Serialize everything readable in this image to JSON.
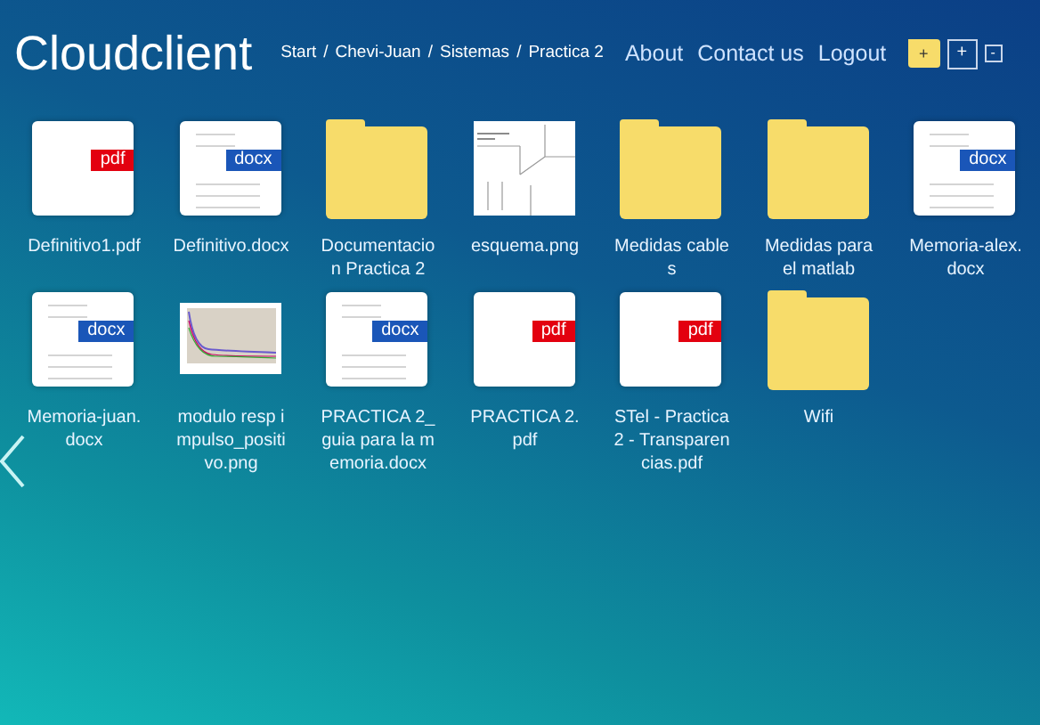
{
  "header": {
    "title": "Cloudclient",
    "breadcrumb": [
      "Start",
      "Chevi-Juan",
      "Sistemas",
      "Practica 2"
    ],
    "breadcrumb_separator": "/",
    "nav": [
      "About",
      "Contact us",
      "Logout"
    ],
    "tools": [
      {
        "kind": "folder",
        "label": "+"
      },
      {
        "kind": "box",
        "label": "+"
      },
      {
        "kind": "small",
        "label": "-"
      }
    ]
  },
  "files": [
    {
      "kind": "pdf",
      "name": "Definitivo1.pdf",
      "tag": "pdf"
    },
    {
      "kind": "docx",
      "name": "Definitivo.docx",
      "tag": "docx"
    },
    {
      "kind": "folder",
      "name": "Documentacion Practica 2"
    },
    {
      "kind": "image",
      "name": "esquema.png"
    },
    {
      "kind": "folder",
      "name": "Medidas cables"
    },
    {
      "kind": "folder",
      "name": "Medidas para el matlab"
    },
    {
      "kind": "docx",
      "name": "Memoria-alex.docx",
      "tag": "docx"
    },
    {
      "kind": "docx",
      "name": "Memoria-juan.docx",
      "tag": "docx"
    },
    {
      "kind": "plot",
      "name": "modulo resp impulso_positivo.png"
    },
    {
      "kind": "docx",
      "name": "PRACTICA 2_guia para la memoria.docx",
      "tag": "docx"
    },
    {
      "kind": "pdf",
      "name": "PRACTICA 2.pdf",
      "tag": "pdf"
    },
    {
      "kind": "pdf",
      "name": "STel - Practica 2 - Transparencias.pdf",
      "tag": "pdf"
    },
    {
      "kind": "folder",
      "name": "Wifi"
    }
  ]
}
